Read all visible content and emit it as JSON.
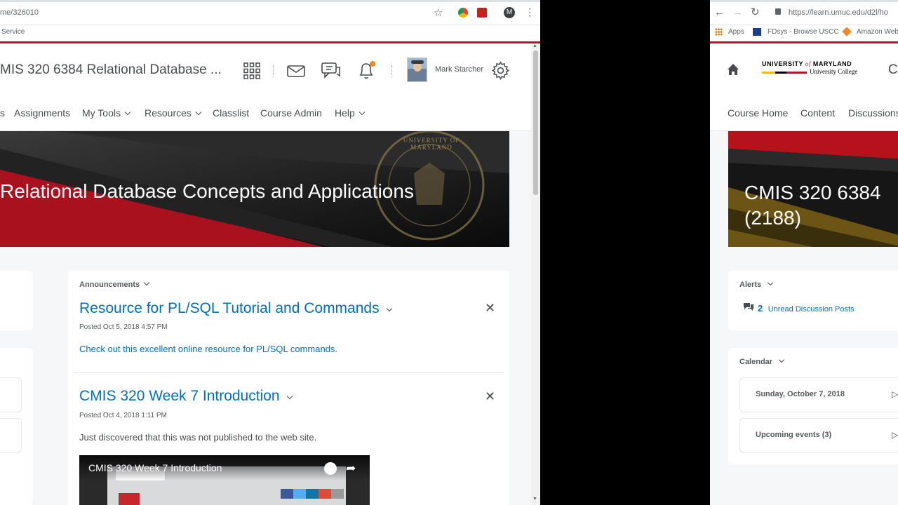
{
  "left_window": {
    "address": "me/326010",
    "bookmark_fragment": "Service",
    "profile_initial": "M",
    "course_title": "MIS 320 6384 Relational Database ...",
    "user_name": "Mark Starcher",
    "menu": {
      "items": [
        "s",
        "Assignments",
        "My Tools",
        "Resources",
        "Classlist",
        "Course Admin",
        "Help"
      ]
    },
    "banner_title": "Relational Database Concepts and Applications",
    "announcements": {
      "header": "Announcements",
      "items": [
        {
          "title": "Resource for PL/SQL Tutorial and Commands",
          "posted": "Posted Oct 5, 2018 4:57 PM",
          "body": "Check out this excellent online resource for PL/SQL commands."
        },
        {
          "title": "CMIS 320 Week 7 Introduction",
          "posted": "Posted Oct 4, 2018 1:11 PM",
          "body": "Just discovered that this was not published to the web site."
        }
      ],
      "video_title": "CMIS 320 Week 7 Introduction"
    }
  },
  "right_window": {
    "address": "https://learn.umuc.edu/d2l/ho",
    "bookmarks": [
      "Apps",
      "FDsys - Browse USCC",
      "Amazon Web"
    ],
    "logo": {
      "line1": "UNIVERSITY",
      "of": "of",
      "line1b": "MARYLAND",
      "line2": "University College"
    },
    "title_fragment": "Cl",
    "menu": [
      "Course Home",
      "Content",
      "Discussions"
    ],
    "banner_title": "CMIS 320 6384 (2188)",
    "alerts": {
      "header": "Alerts",
      "count": "2",
      "label": "Unread Discussion Posts"
    },
    "calendar": {
      "header": "Calendar",
      "date": "Sunday, October 7, 2018",
      "upcoming": "Upcoming events (3)"
    }
  },
  "colors": {
    "brand_red": "#a6192e",
    "link_blue": "#006fbf",
    "notification_orange": "#f08a24"
  }
}
